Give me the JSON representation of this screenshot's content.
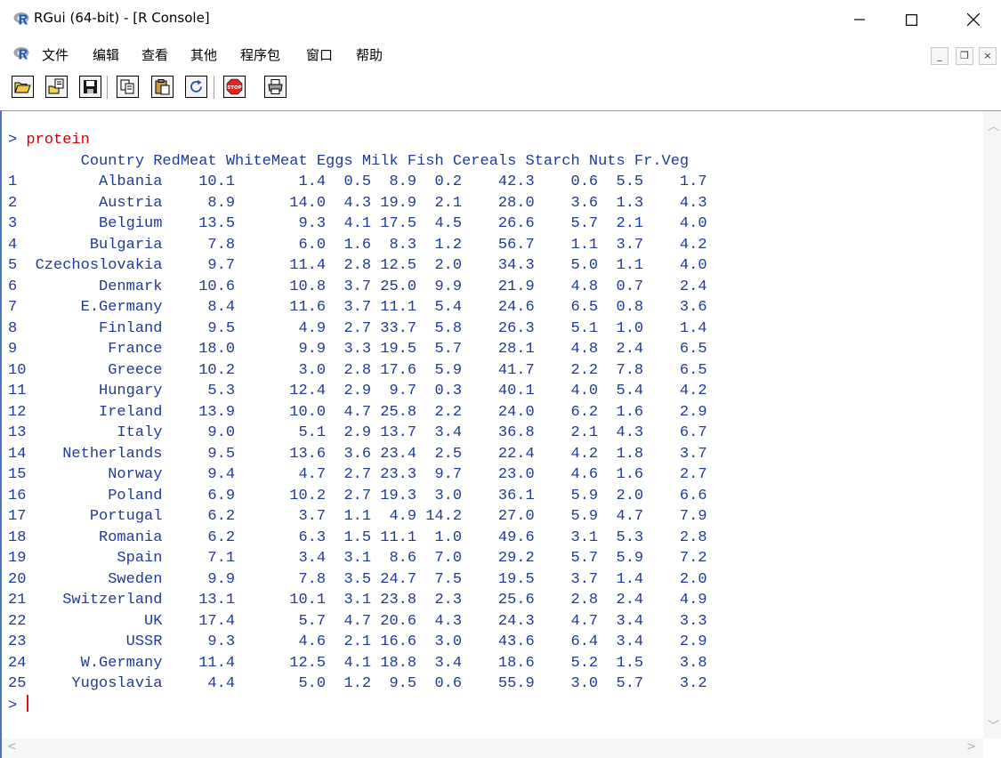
{
  "window": {
    "title": "RGui (64-bit) - [R Console]",
    "minimize": "─",
    "maximize": "☐",
    "close": "✕"
  },
  "menu": {
    "items": [
      "文件",
      "编辑",
      "查看",
      "其他",
      "程序包",
      "窗口",
      "帮助"
    ],
    "mdi_minimize": "_",
    "mdi_restore": "❐",
    "mdi_close": "×"
  },
  "toolbar": {
    "buttons": [
      "open-script",
      "load-workspace",
      "save-workspace",
      "copy",
      "paste",
      "copy-paste",
      "stop",
      "print"
    ]
  },
  "console": {
    "prompt": ">",
    "command": "protein",
    "header": "        Country RedMeat WhiteMeat Eggs Milk Fish Cereals Starch Nuts Fr.Veg",
    "columns": [
      "Country",
      "RedMeat",
      "WhiteMeat",
      "Eggs",
      "Milk",
      "Fish",
      "Cereals",
      "Starch",
      "Nuts",
      "Fr.Veg"
    ],
    "rows": [
      {
        "id": "1",
        "Country": "Albania",
        "RedMeat": "10.1",
        "WhiteMeat": "1.4",
        "Eggs": "0.5",
        "Milk": "8.9",
        "Fish": "0.2",
        "Cereals": "42.3",
        "Starch": "0.6",
        "Nuts": "5.5",
        "FrVeg": "1.7"
      },
      {
        "id": "2",
        "Country": "Austria",
        "RedMeat": "8.9",
        "WhiteMeat": "14.0",
        "Eggs": "4.3",
        "Milk": "19.9",
        "Fish": "2.1",
        "Cereals": "28.0",
        "Starch": "3.6",
        "Nuts": "1.3",
        "FrVeg": "4.3"
      },
      {
        "id": "3",
        "Country": "Belgium",
        "RedMeat": "13.5",
        "WhiteMeat": "9.3",
        "Eggs": "4.1",
        "Milk": "17.5",
        "Fish": "4.5",
        "Cereals": "26.6",
        "Starch": "5.7",
        "Nuts": "2.1",
        "FrVeg": "4.0"
      },
      {
        "id": "4",
        "Country": "Bulgaria",
        "RedMeat": "7.8",
        "WhiteMeat": "6.0",
        "Eggs": "1.6",
        "Milk": "8.3",
        "Fish": "1.2",
        "Cereals": "56.7",
        "Starch": "1.1",
        "Nuts": "3.7",
        "FrVeg": "4.2"
      },
      {
        "id": "5",
        "Country": "Czechoslovakia",
        "RedMeat": "9.7",
        "WhiteMeat": "11.4",
        "Eggs": "2.8",
        "Milk": "12.5",
        "Fish": "2.0",
        "Cereals": "34.3",
        "Starch": "5.0",
        "Nuts": "1.1",
        "FrVeg": "4.0"
      },
      {
        "id": "6",
        "Country": "Denmark",
        "RedMeat": "10.6",
        "WhiteMeat": "10.8",
        "Eggs": "3.7",
        "Milk": "25.0",
        "Fish": "9.9",
        "Cereals": "21.9",
        "Starch": "4.8",
        "Nuts": "0.7",
        "FrVeg": "2.4"
      },
      {
        "id": "7",
        "Country": "E.Germany",
        "RedMeat": "8.4",
        "WhiteMeat": "11.6",
        "Eggs": "3.7",
        "Milk": "11.1",
        "Fish": "5.4",
        "Cereals": "24.6",
        "Starch": "6.5",
        "Nuts": "0.8",
        "FrVeg": "3.6"
      },
      {
        "id": "8",
        "Country": "Finland",
        "RedMeat": "9.5",
        "WhiteMeat": "4.9",
        "Eggs": "2.7",
        "Milk": "33.7",
        "Fish": "5.8",
        "Cereals": "26.3",
        "Starch": "5.1",
        "Nuts": "1.0",
        "FrVeg": "1.4"
      },
      {
        "id": "9",
        "Country": "France",
        "RedMeat": "18.0",
        "WhiteMeat": "9.9",
        "Eggs": "3.3",
        "Milk": "19.5",
        "Fish": "5.7",
        "Cereals": "28.1",
        "Starch": "4.8",
        "Nuts": "2.4",
        "FrVeg": "6.5"
      },
      {
        "id": "10",
        "Country": "Greece",
        "RedMeat": "10.2",
        "WhiteMeat": "3.0",
        "Eggs": "2.8",
        "Milk": "17.6",
        "Fish": "5.9",
        "Cereals": "41.7",
        "Starch": "2.2",
        "Nuts": "7.8",
        "FrVeg": "6.5"
      },
      {
        "id": "11",
        "Country": "Hungary",
        "RedMeat": "5.3",
        "WhiteMeat": "12.4",
        "Eggs": "2.9",
        "Milk": "9.7",
        "Fish": "0.3",
        "Cereals": "40.1",
        "Starch": "4.0",
        "Nuts": "5.4",
        "FrVeg": "4.2"
      },
      {
        "id": "12",
        "Country": "Ireland",
        "RedMeat": "13.9",
        "WhiteMeat": "10.0",
        "Eggs": "4.7",
        "Milk": "25.8",
        "Fish": "2.2",
        "Cereals": "24.0",
        "Starch": "6.2",
        "Nuts": "1.6",
        "FrVeg": "2.9"
      },
      {
        "id": "13",
        "Country": "Italy",
        "RedMeat": "9.0",
        "WhiteMeat": "5.1",
        "Eggs": "2.9",
        "Milk": "13.7",
        "Fish": "3.4",
        "Cereals": "36.8",
        "Starch": "2.1",
        "Nuts": "4.3",
        "FrVeg": "6.7"
      },
      {
        "id": "14",
        "Country": "Netherlands",
        "RedMeat": "9.5",
        "WhiteMeat": "13.6",
        "Eggs": "3.6",
        "Milk": "23.4",
        "Fish": "2.5",
        "Cereals": "22.4",
        "Starch": "4.2",
        "Nuts": "1.8",
        "FrVeg": "3.7"
      },
      {
        "id": "15",
        "Country": "Norway",
        "RedMeat": "9.4",
        "WhiteMeat": "4.7",
        "Eggs": "2.7",
        "Milk": "23.3",
        "Fish": "9.7",
        "Cereals": "23.0",
        "Starch": "4.6",
        "Nuts": "1.6",
        "FrVeg": "2.7"
      },
      {
        "id": "16",
        "Country": "Poland",
        "RedMeat": "6.9",
        "WhiteMeat": "10.2",
        "Eggs": "2.7",
        "Milk": "19.3",
        "Fish": "3.0",
        "Cereals": "36.1",
        "Starch": "5.9",
        "Nuts": "2.0",
        "FrVeg": "6.6"
      },
      {
        "id": "17",
        "Country": "Portugal",
        "RedMeat": "6.2",
        "WhiteMeat": "3.7",
        "Eggs": "1.1",
        "Milk": "4.9",
        "Fish": "14.2",
        "Cereals": "27.0",
        "Starch": "5.9",
        "Nuts": "4.7",
        "FrVeg": "7.9"
      },
      {
        "id": "18",
        "Country": "Romania",
        "RedMeat": "6.2",
        "WhiteMeat": "6.3",
        "Eggs": "1.5",
        "Milk": "11.1",
        "Fish": "1.0",
        "Cereals": "49.6",
        "Starch": "3.1",
        "Nuts": "5.3",
        "FrVeg": "2.8"
      },
      {
        "id": "19",
        "Country": "Spain",
        "RedMeat": "7.1",
        "WhiteMeat": "3.4",
        "Eggs": "3.1",
        "Milk": "8.6",
        "Fish": "7.0",
        "Cereals": "29.2",
        "Starch": "5.7",
        "Nuts": "5.9",
        "FrVeg": "7.2"
      },
      {
        "id": "20",
        "Country": "Sweden",
        "RedMeat": "9.9",
        "WhiteMeat": "7.8",
        "Eggs": "3.5",
        "Milk": "24.7",
        "Fish": "7.5",
        "Cereals": "19.5",
        "Starch": "3.7",
        "Nuts": "1.4",
        "FrVeg": "2.0"
      },
      {
        "id": "21",
        "Country": "Switzerland",
        "RedMeat": "13.1",
        "WhiteMeat": "10.1",
        "Eggs": "3.1",
        "Milk": "23.8",
        "Fish": "2.3",
        "Cereals": "25.6",
        "Starch": "2.8",
        "Nuts": "2.4",
        "FrVeg": "4.9"
      },
      {
        "id": "22",
        "Country": "UK",
        "RedMeat": "17.4",
        "WhiteMeat": "5.7",
        "Eggs": "4.7",
        "Milk": "20.6",
        "Fish": "4.3",
        "Cereals": "24.3",
        "Starch": "4.7",
        "Nuts": "3.4",
        "FrVeg": "3.3"
      },
      {
        "id": "23",
        "Country": "USSR",
        "RedMeat": "9.3",
        "WhiteMeat": "4.6",
        "Eggs": "2.1",
        "Milk": "16.6",
        "Fish": "3.0",
        "Cereals": "43.6",
        "Starch": "6.4",
        "Nuts": "3.4",
        "FrVeg": "2.9"
      },
      {
        "id": "24",
        "Country": "W.Germany",
        "RedMeat": "11.4",
        "WhiteMeat": "12.5",
        "Eggs": "4.1",
        "Milk": "18.8",
        "Fish": "3.4",
        "Cereals": "18.6",
        "Starch": "5.2",
        "Nuts": "1.5",
        "FrVeg": "3.8"
      },
      {
        "id": "25",
        "Country": "Yugoslavia",
        "RedMeat": "4.4",
        "WhiteMeat": "5.0",
        "Eggs": "1.2",
        "Milk": "9.5",
        "Fish": "0.6",
        "Cereals": "55.9",
        "Starch": "3.0",
        "Nuts": "5.7",
        "FrVeg": "3.2"
      }
    ]
  },
  "colors": {
    "console_text": "#1e3b96",
    "command_text": "#d40000",
    "cursor": "#e01010",
    "frame_accent": "#4a72c8"
  }
}
